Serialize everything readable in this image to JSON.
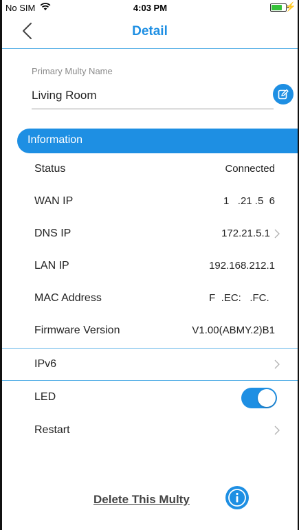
{
  "status_bar": {
    "carrier": "No SIM",
    "time": "4:03 PM",
    "wifi_icon": "wifi-icon",
    "battery_icon": "battery-icon",
    "charging_icon": "charging-bolt-icon"
  },
  "nav": {
    "title": "Detail",
    "back_icon": "chevron-left-icon"
  },
  "name": {
    "label": "Primary Multy Name",
    "value": "Living Room",
    "edit_icon": "edit-icon"
  },
  "information": {
    "header": "Information",
    "rows": [
      {
        "label": "Status",
        "value": "Connected"
      },
      {
        "label": "WAN IP",
        "value": "1   .21 .5  6"
      },
      {
        "label": "DNS IP",
        "value": "172.21.5.1"
      },
      {
        "label": "LAN IP",
        "value": "192.168.212.1"
      },
      {
        "label": "MAC Address",
        "value": "F  .EC:   .FC.  "
      },
      {
        "label": "Firmware Version",
        "value": "V1.00(ABMY.2)B1"
      }
    ]
  },
  "ipv6": {
    "label": "IPv6"
  },
  "led": {
    "label": "LED",
    "enabled": true
  },
  "restart": {
    "label": "Restart"
  },
  "footer": {
    "delete_label": "Delete This Multy",
    "info_icon": "info-icon"
  },
  "colors": {
    "accent": "#1e8fe3",
    "divider": "#5fb4e8",
    "toggle_on": "#1e8fe3"
  }
}
